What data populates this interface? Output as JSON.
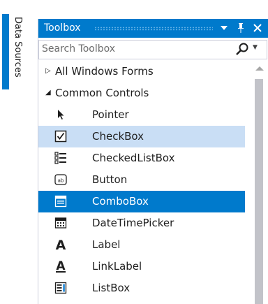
{
  "side_tab": {
    "label": "Data Sources"
  },
  "toolbox": {
    "title": "Toolbox",
    "buttons": {
      "dropdown": "▼",
      "pin": "📌",
      "close": "✕"
    },
    "search": {
      "placeholder": "Search Toolbox"
    },
    "groups": [
      {
        "label": "All Windows Forms",
        "expanded": false
      },
      {
        "label": "Common Controls",
        "expanded": true
      }
    ],
    "items": [
      {
        "label": "Pointer",
        "icon": "pointer-icon",
        "state": "normal"
      },
      {
        "label": "CheckBox",
        "icon": "checkbox-icon",
        "state": "hover"
      },
      {
        "label": "CheckedListBox",
        "icon": "checkedlistbox-icon",
        "state": "normal"
      },
      {
        "label": "Button",
        "icon": "button-icon",
        "state": "normal"
      },
      {
        "label": "ComboBox",
        "icon": "combobox-icon",
        "state": "selected"
      },
      {
        "label": "DateTimePicker",
        "icon": "datetimepicker-icon",
        "state": "normal"
      },
      {
        "label": "Label",
        "icon": "label-icon",
        "state": "normal"
      },
      {
        "label": "LinkLabel",
        "icon": "linklabel-icon",
        "state": "normal"
      },
      {
        "label": "ListBox",
        "icon": "listbox-icon",
        "state": "normal"
      }
    ]
  },
  "colors": {
    "accent": "#007acc",
    "hover": "#c9def5",
    "border": "#cccedb",
    "scroll_thumb": "#c2c3c9"
  }
}
